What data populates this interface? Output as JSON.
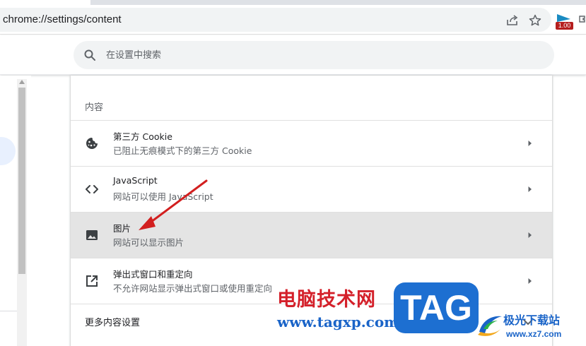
{
  "browser": {
    "url": "chrome://settings/content",
    "extension_badge": "1.00"
  },
  "search": {
    "placeholder": "在设置中搜索"
  },
  "content": {
    "section_title": "内容",
    "rows": [
      {
        "title": "第三方 Cookie",
        "subtitle": "已阻止无痕模式下的第三方 Cookie",
        "icon": "cookie-icon"
      },
      {
        "title": "JavaScript",
        "subtitle": "网站可以使用 JavaScript",
        "icon": "code-icon"
      },
      {
        "title": "图片",
        "subtitle": "网站可以显示图片",
        "icon": "image-icon",
        "highlighted": true
      },
      {
        "title": "弹出式窗口和重定向",
        "subtitle": "不允许网站显示弹出式窗口或使用重定向",
        "icon": "open-in-new-icon"
      }
    ],
    "more_label": "更多内容设置"
  },
  "watermark": {
    "cn_text": "电脑技术网",
    "url_text": "www.tagxp.com",
    "tag_text": "TAG",
    "site_cn": "极光下载站",
    "site_url": "www.xz7.com"
  },
  "colors": {
    "highlight_row": "#e4e4e4",
    "arrow": "#d21f1f",
    "watermark_red": "#d4202a",
    "watermark_blue": "#1a64c8"
  }
}
